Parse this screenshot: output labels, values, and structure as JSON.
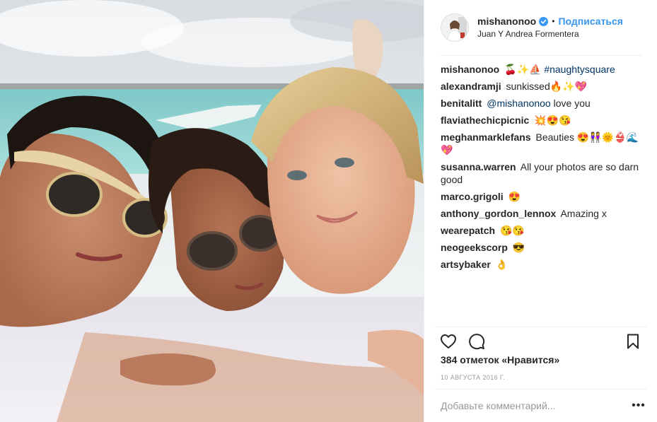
{
  "post": {
    "photo_alt": "Фото публикации",
    "author": {
      "username": "mishanonoo",
      "verified": true,
      "follow_label": "Подписаться",
      "location": "Juan Y Andrea Formentera"
    },
    "comments": [
      {
        "user": "mishanonoo",
        "text": "🍒✨⛵",
        "link": "#naughtysquare"
      },
      {
        "user": "alexandramji",
        "text": "sunkissed🔥✨💖"
      },
      {
        "user": "benitalitt",
        "link": "@mishanonoo",
        "text": " love you"
      },
      {
        "user": "flaviathechicpicnic",
        "text": "💥😍😘"
      },
      {
        "user": "meghanmarklefans",
        "text": "Beauties 😍👭🌞👙🌊💖"
      },
      {
        "user": "susanna.warren",
        "text": "All your photos are so darn good"
      },
      {
        "user": "marco.grigoli",
        "text": "😍"
      },
      {
        "user": "anthony_gordon_lennox",
        "text": "Amazing x"
      },
      {
        "user": "wearepatch",
        "text": "😘😘"
      },
      {
        "user": "neogeekscorp",
        "text": "😎"
      },
      {
        "user": "artsybaker",
        "text": "👌"
      }
    ],
    "likes_text": "384 отметок «Нравится»",
    "date": "10 АВГУСТА 2016 Г.",
    "add_comment_placeholder": "Добавьте комментарий...",
    "more_label": "•••",
    "icons": {
      "like": "heart-icon",
      "comment": "comment-icon",
      "save": "bookmark-icon",
      "verified": "verified-badge-icon",
      "more": "more-options-icon"
    },
    "colors": {
      "link": "#003569",
      "follow": "#3897f0",
      "muted": "#999999",
      "border": "#efefef"
    }
  }
}
